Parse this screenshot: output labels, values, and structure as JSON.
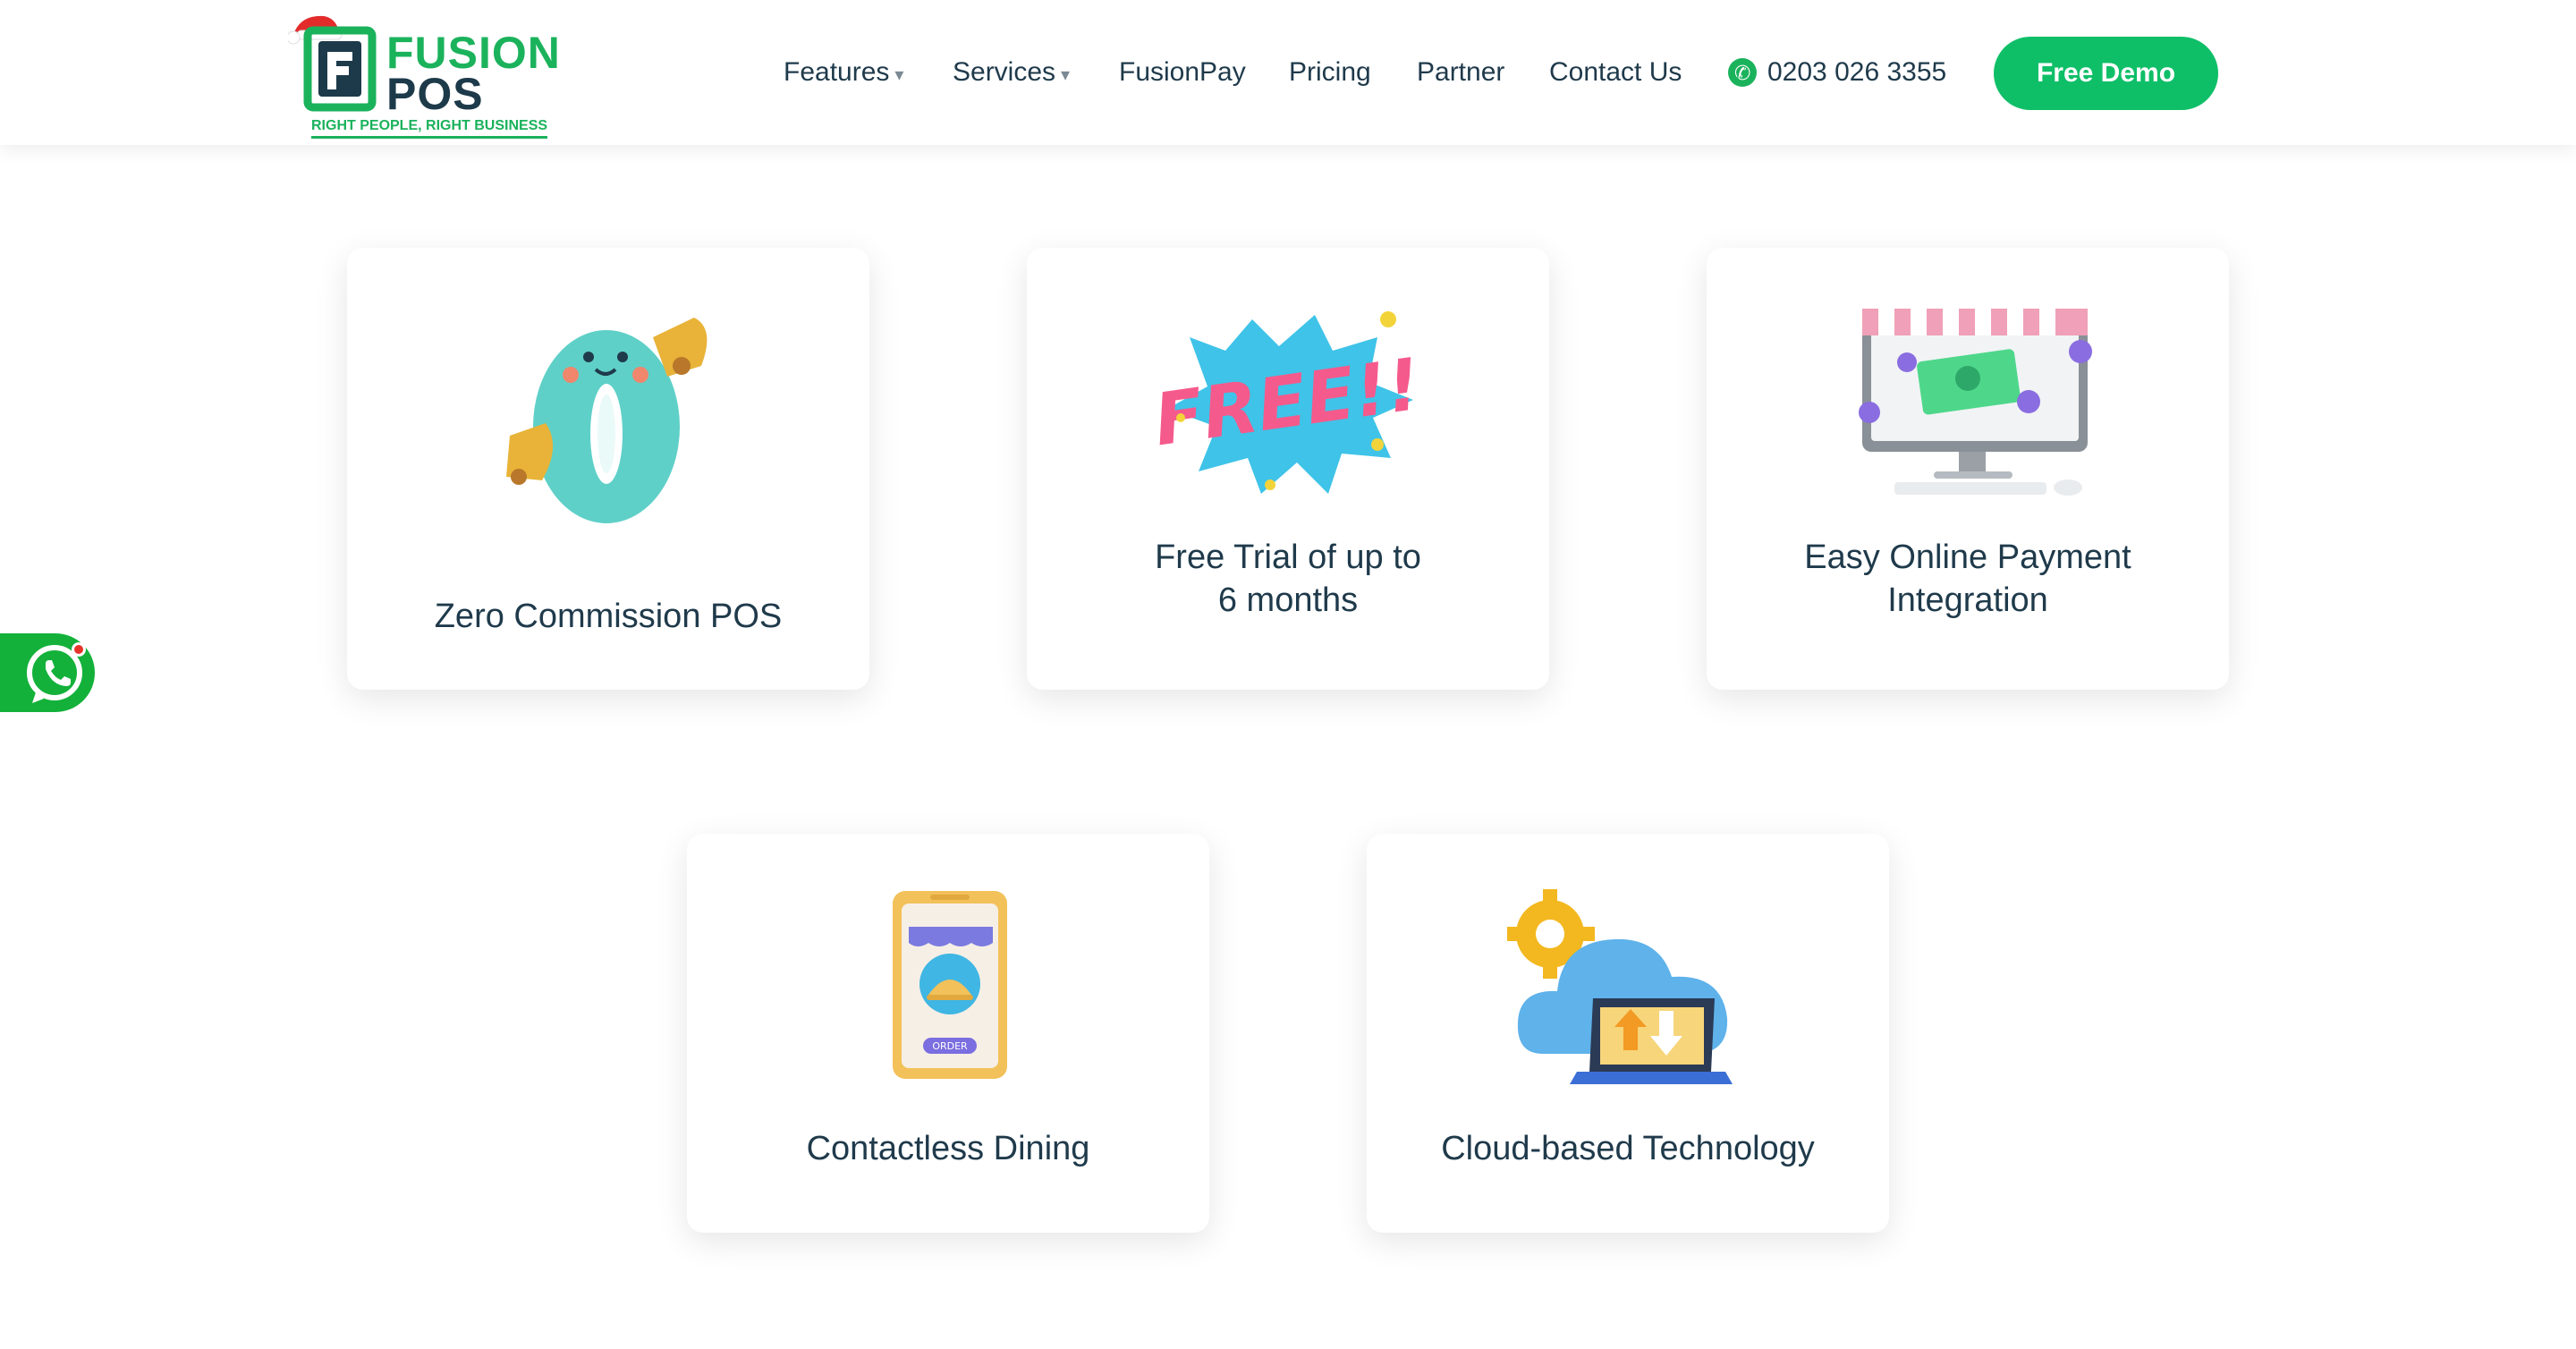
{
  "brand": {
    "name_line1": "FUSION",
    "name_line2": "POS",
    "tagline": "RIGHT PEOPLE, RIGHT BUSINESS",
    "green": "#1bb25c",
    "navy": "#1d3a4a"
  },
  "nav": {
    "items": [
      {
        "label": "Features",
        "caret": "▾"
      },
      {
        "label": "Services",
        "caret": "▾"
      },
      {
        "label": "FusionPay"
      },
      {
        "label": "Pricing"
      },
      {
        "label": "Partner"
      },
      {
        "label": "Contact Us"
      }
    ],
    "phone": "0203 026 3355",
    "cta": "Free Demo"
  },
  "features": [
    {
      "title": "Zero Commission POS",
      "icon": "zero-bells-icon"
    },
    {
      "title_line1": "Free Trial of up to",
      "title_line2": "6 months",
      "icon": "free-burst-icon"
    },
    {
      "title_line1": "Easy Online Payment",
      "title_line2": "Integration",
      "icon": "monitor-shop-icon"
    },
    {
      "title": "Contactless Dining",
      "icon": "phone-order-icon"
    },
    {
      "title": "Cloud-based Technology",
      "icon": "cloud-laptop-icon"
    }
  ],
  "whatsapp": {
    "icon": "whatsapp-icon",
    "color": "#13b13a"
  }
}
